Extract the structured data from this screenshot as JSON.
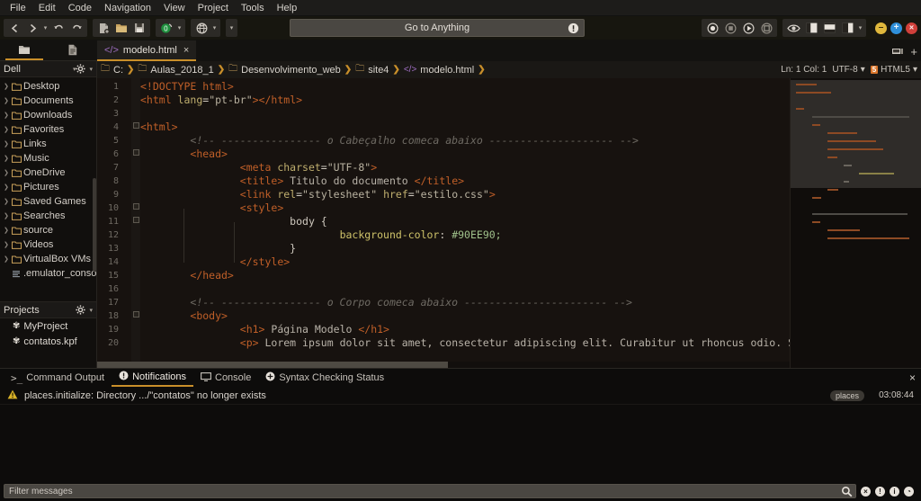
{
  "menubar": {
    "items": [
      "File",
      "Edit",
      "Code",
      "Navigation",
      "View",
      "Project",
      "Tools",
      "Help"
    ]
  },
  "toolbar": {
    "back_icon": "arrow-left-icon",
    "forward_icon": "arrow-right-icon",
    "undo_icon": "undo-icon",
    "redo_icon": "redo-icon",
    "new_file_icon": "new-file-icon",
    "open_folder_icon": "open-folder-icon",
    "save_icon": "save-icon",
    "run_icon": "run-green-icon",
    "preview_browser_icon": "globe-icon",
    "extra_caret_icon": "chevron-down-icon",
    "goto_anything": {
      "placeholder": "Go to Anything",
      "value": "",
      "info_icon": "info-icon"
    },
    "macro_record_icon": "record-icon",
    "macro_stop_icon": "stop-icon",
    "macro_play_icon": "play-icon",
    "macro_save_icon": "save-macro-icon",
    "eye_icon": "eye-icon",
    "layout_left_icon": "pane-left-icon",
    "layout_bottom_icon": "pane-bottom-icon",
    "layout_right_icon": "pane-right-icon",
    "layout_caret_icon": "chevron-down-icon",
    "minus_label": "–",
    "plus_label": "+",
    "close_label": "×"
  },
  "left_pane_tabs": [
    {
      "name": "places-tab",
      "icon": "folder-icon",
      "active": true
    },
    {
      "name": "open-files-tab",
      "icon": "file-icon",
      "active": false
    }
  ],
  "editor_tabs": [
    {
      "label": "modelo.html",
      "icon": "code-tag-icon",
      "close_label": "×",
      "active": true
    }
  ],
  "tabrow_right": {
    "toolbar_icon": "tab-overflow-icon",
    "add_label": "+"
  },
  "sidebar": {
    "places": {
      "title": "Dell",
      "caret_icon": "chevron-down-icon",
      "gear_icon": "gear-icon",
      "gear_caret_icon": "chevron-down-icon",
      "items": [
        {
          "label": "Desktop",
          "type": "folder"
        },
        {
          "label": "Documents",
          "type": "folder"
        },
        {
          "label": "Downloads",
          "type": "folder"
        },
        {
          "label": "Favorites",
          "type": "folder"
        },
        {
          "label": "Links",
          "type": "folder"
        },
        {
          "label": "Music",
          "type": "folder"
        },
        {
          "label": "OneDrive",
          "type": "folder"
        },
        {
          "label": "Pictures",
          "type": "folder"
        },
        {
          "label": "Saved Games",
          "type": "folder"
        },
        {
          "label": "Searches",
          "type": "folder"
        },
        {
          "label": "source",
          "type": "folder"
        },
        {
          "label": "Videos",
          "type": "folder"
        },
        {
          "label": "VirtualBox VMs",
          "type": "folder"
        },
        {
          "label": ".emulator_console",
          "type": "file"
        }
      ]
    },
    "projects": {
      "title": "Projects",
      "gear_icon": "gear-icon",
      "gear_caret_icon": "chevron-down-icon",
      "items": [
        {
          "label": "MyProject",
          "icon": "project-icon"
        },
        {
          "label": "contatos.kpf",
          "icon": "project-icon"
        }
      ]
    }
  },
  "breadcrumb": {
    "items": [
      {
        "label": "C:",
        "icon": "folder-icon"
      },
      {
        "label": "Aulas_2018_1",
        "icon": "folder-icon"
      },
      {
        "label": "Desenvolvimento_web",
        "icon": "folder-icon"
      },
      {
        "label": "site4",
        "icon": "folder-icon"
      },
      {
        "label": "modelo.html",
        "icon": "code-tag-icon"
      }
    ],
    "separator": "❯"
  },
  "editor_status": {
    "position": "Ln: 1 Col: 1",
    "encoding": "UTF-8",
    "encoding_caret": "chevron-down-icon",
    "language_badge": "5",
    "language": "HTML5",
    "language_caret": "chevron-down-icon"
  },
  "code": {
    "line_count": 20,
    "lines": [
      {
        "n": 1,
        "html": "<span class='tag'>&lt;!DOCTYPE html&gt;</span>"
      },
      {
        "n": 2,
        "html": "<span class='tag'>&lt;html </span><span class='attr'>lang</span><span class='plain'>=</span><span class='str'>\"pt-br\"</span><span class='tag'>&gt;&lt;/html&gt;</span>"
      },
      {
        "n": 3,
        "html": ""
      },
      {
        "n": 4,
        "html": "<span class='tag'>&lt;html&gt;</span>"
      },
      {
        "n": 5,
        "html": "        <span class='cmt'>&lt;!-- ---------------- o Cabeçalho comeca abaixo -------------------- --&gt;</span>"
      },
      {
        "n": 6,
        "html": "        <span class='tag'>&lt;head&gt;</span>"
      },
      {
        "n": 7,
        "html": "                <span class='tag'>&lt;meta </span><span class='attr'>charset</span><span class='plain'>=</span><span class='str'>\"UTF-8\"</span><span class='tag'>&gt;</span>"
      },
      {
        "n": 8,
        "html": "                <span class='tag'>&lt;title&gt;</span><span class='txt'> Titulo do documento </span><span class='tag'>&lt;/title&gt;</span>"
      },
      {
        "n": 9,
        "html": "                <span class='tag'>&lt;link </span><span class='attr'>rel</span><span class='plain'>=</span><span class='str'>\"stylesheet\"</span><span class='plain'> </span><span class='attr'>href</span><span class='plain'>=</span><span class='str'>\"estilo.css\"</span><span class='tag'>&gt;</span>"
      },
      {
        "n": 10,
        "html": "                <span class='tag'>&lt;style&gt;</span>"
      },
      {
        "n": 11,
        "html": "                        <span class='plain'>body {</span>"
      },
      {
        "n": 12,
        "html": "                                <span class='cssprop'>background-color</span><span class='plain'>: </span><span class='cssval'>#90EE90;</span>"
      },
      {
        "n": 13,
        "html": "                        <span class='plain'>}</span>"
      },
      {
        "n": 14,
        "html": "                <span class='tag'>&lt;/style&gt;</span>"
      },
      {
        "n": 15,
        "html": "        <span class='tag'>&lt;/head&gt;</span>"
      },
      {
        "n": 16,
        "html": ""
      },
      {
        "n": 17,
        "html": "        <span class='cmt'>&lt;!-- ---------------- o Corpo comeca abaixo ----------------------- --&gt;</span>"
      },
      {
        "n": 18,
        "html": "        <span class='tag'>&lt;body&gt;</span>"
      },
      {
        "n": 19,
        "html": "                <span class='tag'>&lt;h1&gt;</span><span class='txt'> Página Modelo </span><span class='tag'>&lt;/h1&gt;</span>"
      },
      {
        "n": 20,
        "html": "                <span class='tag'>&lt;p&gt;</span><span class='txt'> Lorem ipsum dolor sit amet, consectetur adipiscing elit. Curabitur ut rhoncus odio. Sed a euismod est. N</span>"
      }
    ]
  },
  "bottom_panel": {
    "tabs": [
      {
        "label": "Command Output",
        "icon": "terminal-icon",
        "active": false
      },
      {
        "label": "Notifications",
        "icon": "info-icon",
        "active": true
      },
      {
        "label": "Console",
        "icon": "monitor-icon",
        "active": false
      },
      {
        "label": "Syntax Checking Status",
        "icon": "plus-circle-icon",
        "active": false
      }
    ],
    "close_label": "×",
    "notifications": [
      {
        "icon": "warning-icon",
        "message": "places.initialize: Directory .../\"contatos\" no longer exists",
        "source": "places",
        "time": "03:08:44"
      }
    ],
    "filter": {
      "placeholder": "Filter messages",
      "value": "",
      "search_icon": "search-icon"
    },
    "status_icons": [
      {
        "name": "error-count-icon",
        "glyph": "×"
      },
      {
        "name": "warning-count-icon",
        "glyph": "!"
      },
      {
        "name": "info-count-icon",
        "glyph": "i"
      },
      {
        "name": "history-icon",
        "glyph": "◔"
      }
    ]
  },
  "colors": {
    "accent": "#c98f2a",
    "tag": "#c05f28",
    "attr": "#bfae6e",
    "comment": "#6e6a63",
    "css_value": "#90EE90"
  }
}
